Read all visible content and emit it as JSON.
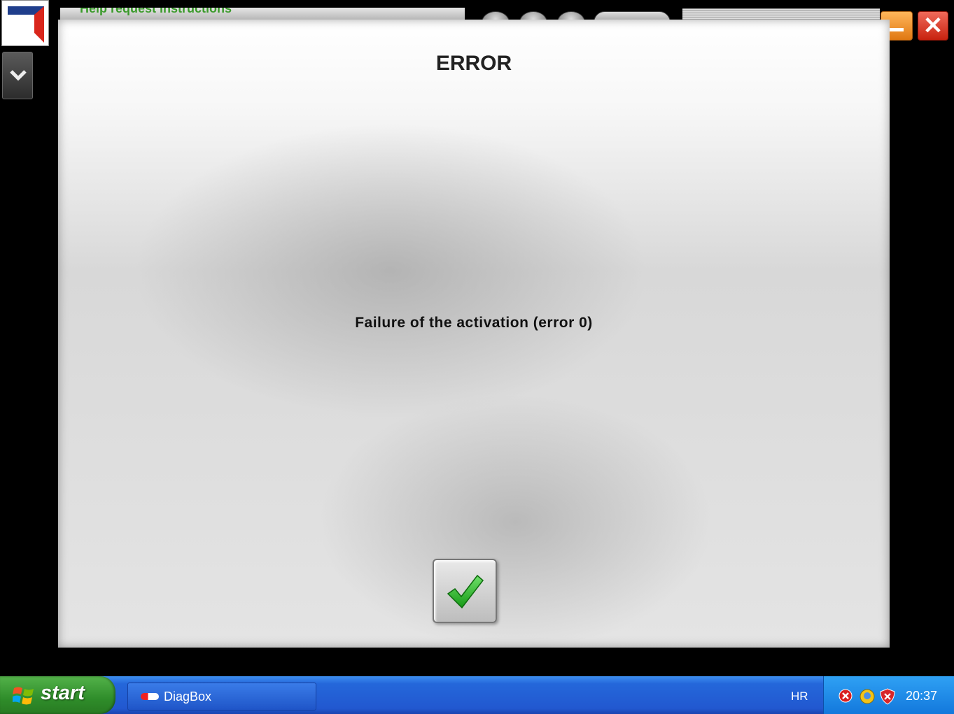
{
  "background": {
    "header_text": "Help request instructions"
  },
  "dialog": {
    "title": "ERROR",
    "message": "Failure of the activation (error 0)"
  },
  "window_controls": {
    "close_glyph": "✕"
  },
  "taskbar": {
    "start_label": "start",
    "task_label": "DiagBox",
    "language": "HR",
    "clock": "20:37"
  },
  "colors": {
    "checkmark": "#2aa82a",
    "taskbar": "#2458d0",
    "start_button": "#3a9a32"
  },
  "icons": [
    "app-logo-icon",
    "chevron-down-icon",
    "checkmark-icon",
    "windows-flag-icon",
    "diagbox-icon",
    "security-alert-icon",
    "network-icon",
    "shield-icon"
  ]
}
